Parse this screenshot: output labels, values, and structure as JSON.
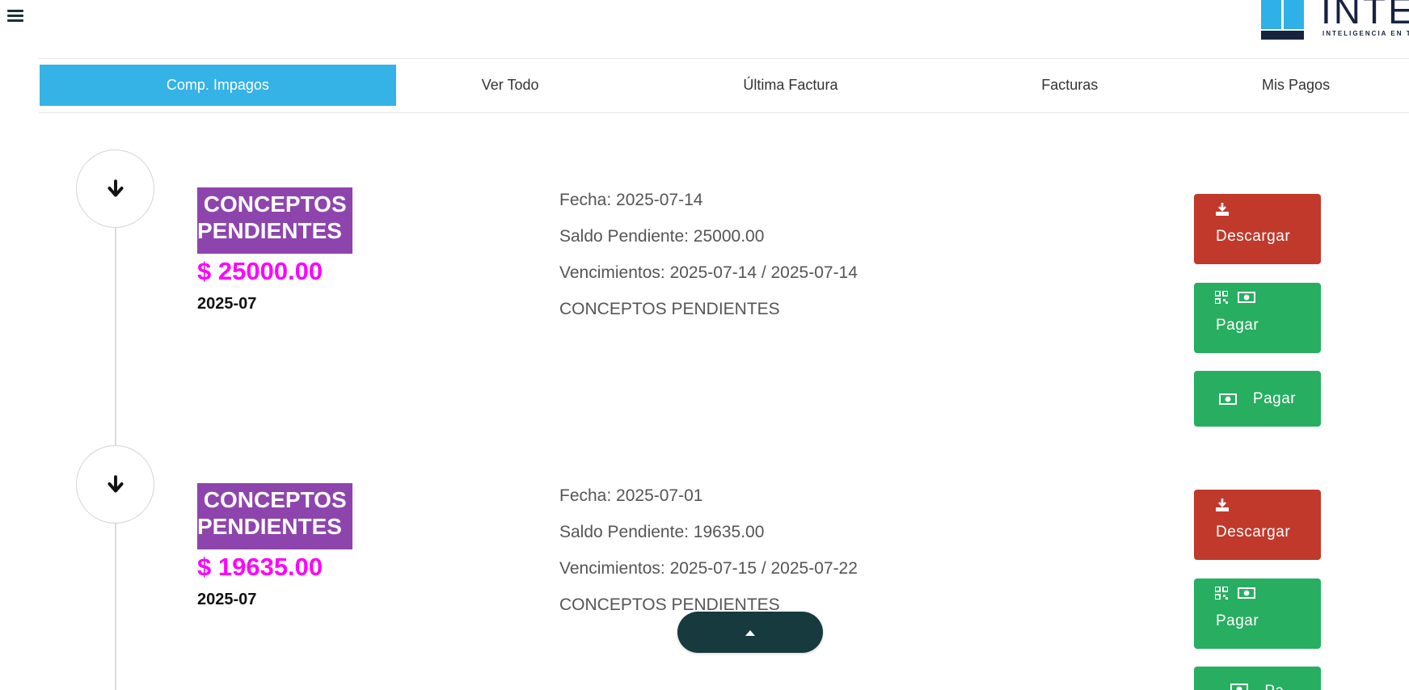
{
  "header": {
    "menu_icon": "hamburger-icon",
    "logo_text": "INTEL",
    "logo_tagline": "INTELIGENCIA EN TE"
  },
  "tabs": [
    {
      "label": "Comp. Impagos",
      "active": true
    },
    {
      "label": "Ver Todo",
      "active": false
    },
    {
      "label": "Última Factura",
      "active": false
    },
    {
      "label": "Facturas",
      "active": false
    },
    {
      "label": "Mis Pagos",
      "active": false
    }
  ],
  "entries": [
    {
      "icon": "arrow-down-icon",
      "badge_line1": " CONCEPTOS",
      "badge_line2": "PENDIENTES",
      "amount": "$ 25000.00",
      "period": "2025-07",
      "fecha": "Fecha: 2025-07-14",
      "saldo": "Saldo Pendiente: 25000.00",
      "vencimientos": "Vencimientos: 2025-07-14 / 2025-07-14",
      "concepto": "CONCEPTOS PENDIENTES",
      "buttons": {
        "download": "Descargar",
        "pay_qr": "Pagar",
        "pay_cash": "Pagar"
      }
    },
    {
      "icon": "arrow-down-icon",
      "badge_line1": " CONCEPTOS",
      "badge_line2": "PENDIENTES",
      "amount": "$ 19635.00",
      "period": "2025-07",
      "fecha": "Fecha: 2025-07-01",
      "saldo": "Saldo Pendiente: 19635.00",
      "vencimientos": "Vencimientos: 2025-07-15 / 2025-07-22",
      "concepto": "CONCEPTOS PENDIENTES",
      "buttons": {
        "download": "Descargar",
        "pay_qr": "Pagar",
        "pay_cash": "Pa"
      }
    }
  ],
  "colors": {
    "active_tab": "#35b3e6",
    "badge": "#8e44ad",
    "amount": "#ff00ff",
    "download_button": "#c0392b",
    "pay_button": "#27ae60",
    "back_to_top": "#163a3e"
  },
  "back_to_top_icon": "caret-up-icon"
}
